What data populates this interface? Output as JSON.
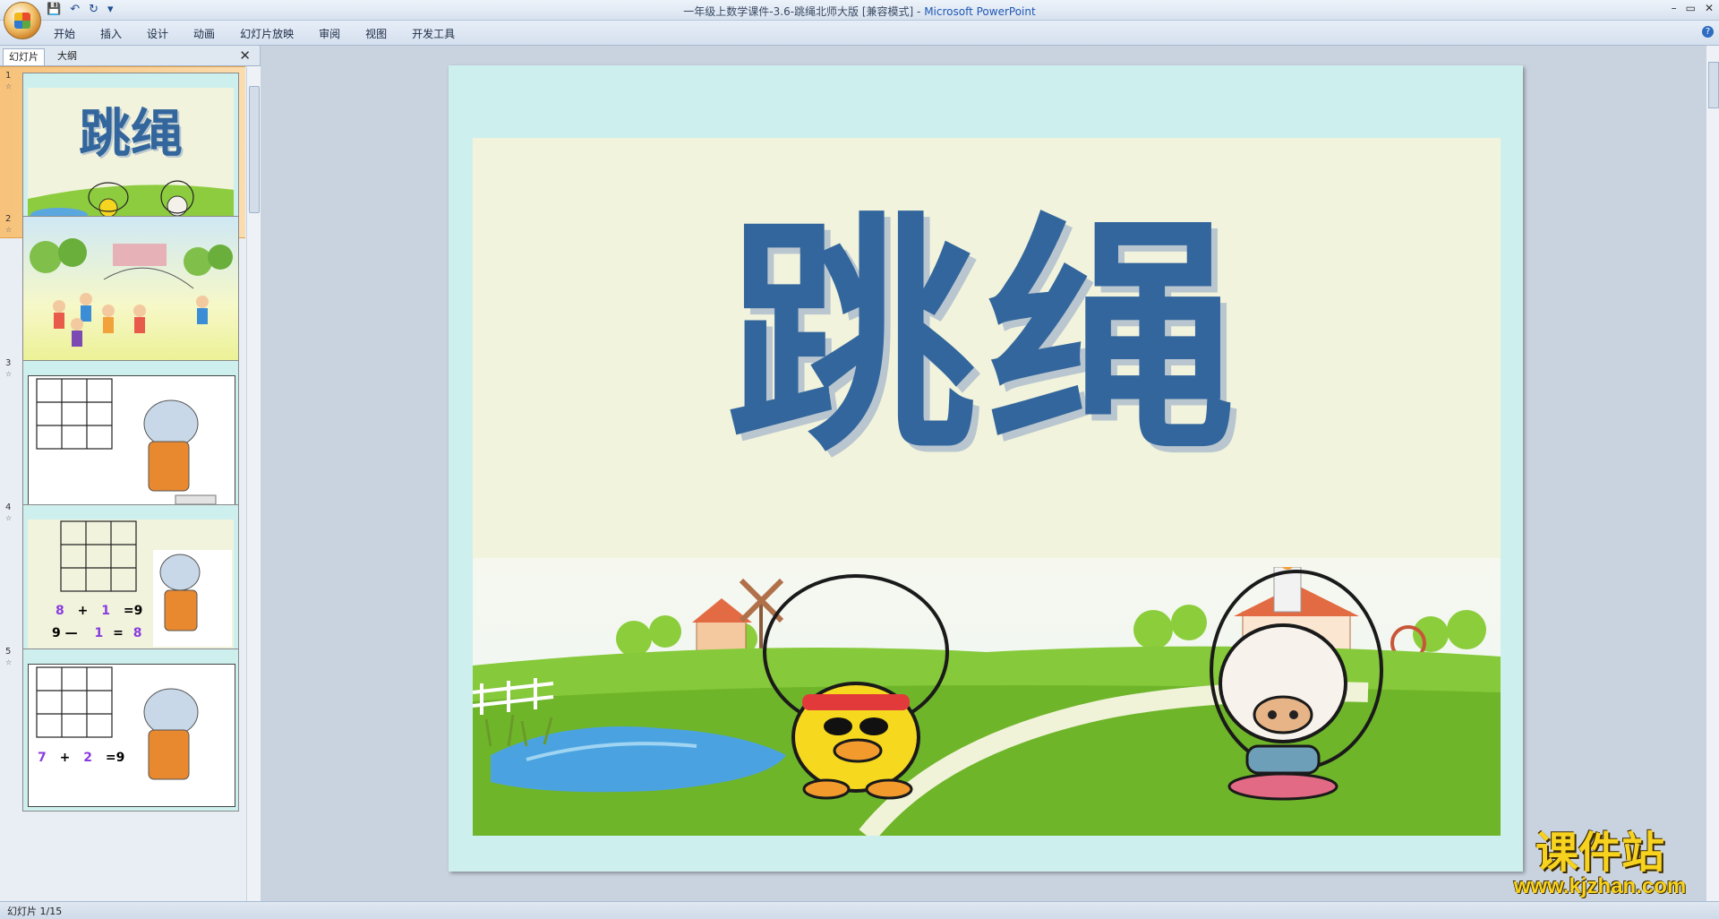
{
  "window": {
    "doc_title": "一年级上数学课件-3.6-跳绳北师大版 [兼容模式]",
    "separator": " - ",
    "app_name": "Microsoft PowerPoint",
    "controls": {
      "minimize": "–",
      "restore": "▭",
      "close": "✕"
    }
  },
  "qat": {
    "save": "💾",
    "undo": "↶",
    "redo": "↻",
    "customize": "▾"
  },
  "menu": {
    "items": [
      "开始",
      "插入",
      "设计",
      "动画",
      "幻灯片放映",
      "审阅",
      "视图",
      "开发工具"
    ],
    "help": "?"
  },
  "panel": {
    "tabs": [
      "幻灯片",
      "大纲"
    ],
    "close": "✕",
    "thumbnails": [
      {
        "num": "1",
        "title": "跳绳"
      },
      {
        "num": "2"
      },
      {
        "num": "3"
      },
      {
        "num": "4",
        "eq1": [
          "8",
          "+",
          "1",
          "=9"
        ],
        "eq2": [
          "9",
          "—",
          "1",
          "=",
          "8"
        ]
      },
      {
        "num": "5",
        "eq1": [
          "7",
          "+",
          "2",
          "=9"
        ]
      }
    ]
  },
  "slide": {
    "title": "跳绳"
  },
  "status": {
    "text": "幻灯片 1/15"
  },
  "watermark": {
    "cn": "课件站",
    "url": "www.kjzhan.com"
  },
  "colors": {
    "title": "#33669c",
    "accent_selection": "#f7c27a",
    "eq_purple": "#8a3be0"
  }
}
